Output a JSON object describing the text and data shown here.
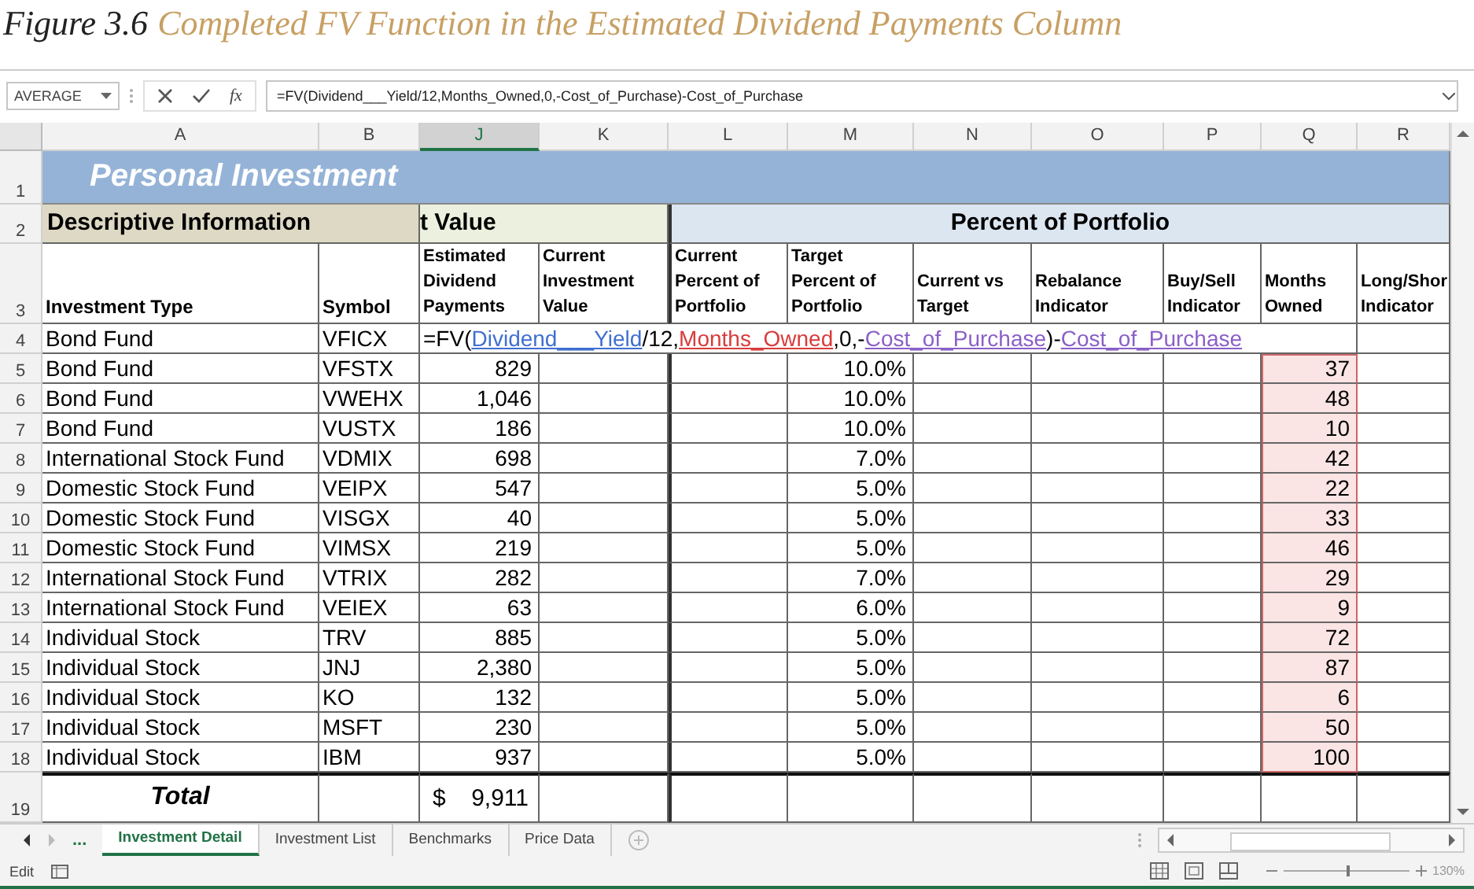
{
  "caption": {
    "label": "Figure 3.6",
    "title": "Completed FV Function in the Estimated Dividend Payments Column"
  },
  "name_box": "AVERAGE",
  "formula_bar": {
    "fx": "fx",
    "formula": "=FV(Dividend___Yield/12,Months_Owned,0,-Cost_of_Purchase)-Cost_of_Purchase"
  },
  "column_headers": [
    {
      "label": "A",
      "selected": false
    },
    {
      "label": "B",
      "selected": false
    },
    {
      "label": "J",
      "selected": true
    },
    {
      "label": "K",
      "selected": false
    },
    {
      "label": "L",
      "selected": false
    },
    {
      "label": "M",
      "selected": false
    },
    {
      "label": "N",
      "selected": false
    },
    {
      "label": "O",
      "selected": false
    },
    {
      "label": "P",
      "selected": false
    },
    {
      "label": "Q",
      "selected": false
    },
    {
      "label": "R",
      "selected": false
    }
  ],
  "title_row": {
    "num": "1",
    "text": "Personal Investment"
  },
  "group_row": {
    "num": "2",
    "groups": [
      {
        "label": "Descriptive Information",
        "kind": "descriptive"
      },
      {
        "label": "t Value",
        "kind": "value"
      },
      {
        "label": "Percent of Portfolio",
        "kind": "percent"
      }
    ]
  },
  "header_row": {
    "num": "3",
    "labels": [
      [
        "Investment Type"
      ],
      [
        "Symbol"
      ],
      [
        "Estimated",
        "Dividend",
        "Payments"
      ],
      [
        "Current",
        "Investment",
        "Value"
      ],
      [
        "Current",
        "Percent of",
        "Portfolio"
      ],
      [
        "Target",
        "Percent of",
        "Portfolio"
      ],
      [
        "Current vs",
        "Target"
      ],
      [
        "Rebalance",
        "Indicator"
      ],
      [
        "Buy/Sell",
        "Indicator"
      ],
      [
        "Months",
        "Owned"
      ],
      [
        "Long/Shor",
        "Indicator"
      ]
    ]
  },
  "edit_row": {
    "num": "4",
    "type": "Bond Fund",
    "symbol": "VFICX",
    "formula": [
      {
        "text": "=FV(",
        "kind": "plain"
      },
      {
        "text": "Dividend___Yield",
        "kind": "ref",
        "color": "#3f6fd0"
      },
      {
        "text": "/12,",
        "kind": "plain"
      },
      {
        "text": "Months_Owned",
        "kind": "ref",
        "color": "#d93b3b"
      },
      {
        "text": ",0,-",
        "kind": "plain"
      },
      {
        "text": "Cost_of_Purchase",
        "kind": "ref",
        "color": "#8b5fc8"
      },
      {
        "text": ")-",
        "kind": "plain"
      },
      {
        "text": "Cost_of_Purchase",
        "kind": "ref",
        "color": "#8b5fc8"
      }
    ]
  },
  "months_range_highlighted": true,
  "rows": [
    {
      "num": "5",
      "type": "Bond Fund",
      "symbol": "VFSTX",
      "dividend": "829",
      "target": "10.0%",
      "months": "37"
    },
    {
      "num": "6",
      "type": "Bond Fund",
      "symbol": "VWEHX",
      "dividend": "1,046",
      "target": "10.0%",
      "months": "48"
    },
    {
      "num": "7",
      "type": "Bond Fund",
      "symbol": "VUSTX",
      "dividend": "186",
      "target": "10.0%",
      "months": "10"
    },
    {
      "num": "8",
      "type": "International Stock Fund",
      "symbol": "VDMIX",
      "dividend": "698",
      "target": "7.0%",
      "months": "42"
    },
    {
      "num": "9",
      "type": "Domestic Stock Fund",
      "symbol": "VEIPX",
      "dividend": "547",
      "target": "5.0%",
      "months": "22"
    },
    {
      "num": "10",
      "type": "Domestic Stock Fund",
      "symbol": "VISGX",
      "dividend": "40",
      "target": "5.0%",
      "months": "33"
    },
    {
      "num": "11",
      "type": "Domestic Stock Fund",
      "symbol": "VIMSX",
      "dividend": "219",
      "target": "5.0%",
      "months": "46"
    },
    {
      "num": "12",
      "type": "International Stock Fund",
      "symbol": "VTRIX",
      "dividend": "282",
      "target": "7.0%",
      "months": "29"
    },
    {
      "num": "13",
      "type": "International Stock Fund",
      "symbol": "VEIEX",
      "dividend": "63",
      "target": "6.0%",
      "months": "9"
    },
    {
      "num": "14",
      "type": "Individual Stock",
      "symbol": "TRV",
      "dividend": "885",
      "target": "5.0%",
      "months": "72"
    },
    {
      "num": "15",
      "type": "Individual Stock",
      "symbol": "JNJ",
      "dividend": "2,380",
      "target": "5.0%",
      "months": "87"
    },
    {
      "num": "16",
      "type": "Individual Stock",
      "symbol": "KO",
      "dividend": "132",
      "target": "5.0%",
      "months": "6"
    },
    {
      "num": "17",
      "type": "Individual Stock",
      "symbol": "MSFT",
      "dividend": "230",
      "target": "5.0%",
      "months": "50"
    },
    {
      "num": "18",
      "type": "Individual Stock",
      "symbol": "IBM",
      "dividend": "937",
      "target": "5.0%",
      "months": "100"
    }
  ],
  "total_row": {
    "num": "19",
    "label": "Total",
    "currency": "$",
    "amount": "9,911"
  },
  "tab_ellipsis": "...",
  "sheet_tabs": [
    {
      "label": "Investment Detail",
      "selected": true
    },
    {
      "label": "Investment List",
      "selected": false
    },
    {
      "label": "Benchmarks",
      "selected": false
    },
    {
      "label": "Price Data",
      "selected": false
    }
  ],
  "status_bar": {
    "mode": "Edit",
    "zoom": "130%",
    "zoom_slider": {
      "level": 0.5
    }
  }
}
